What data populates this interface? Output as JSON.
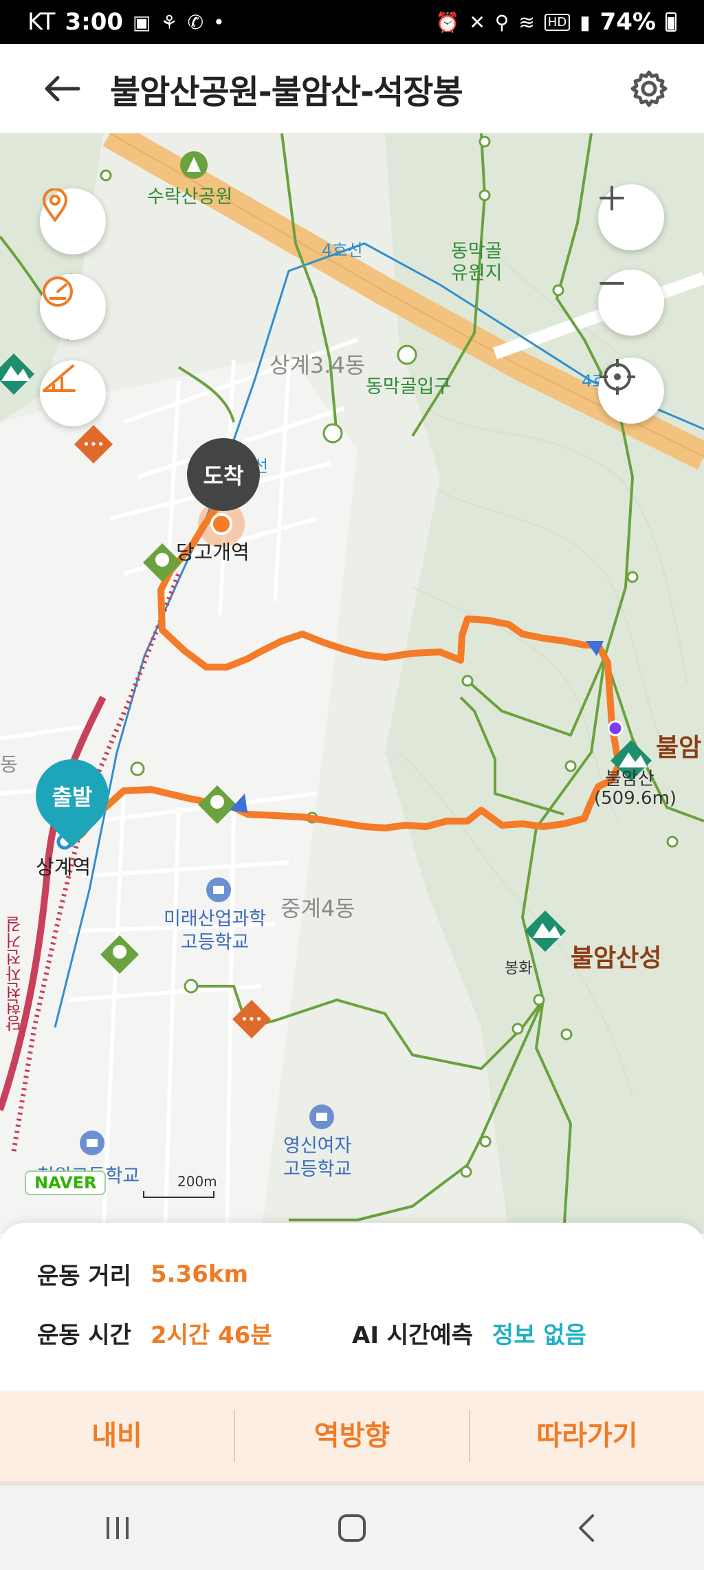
{
  "status_bar": {
    "carrier": "KT",
    "time": "3:00",
    "battery": "74%",
    "left_icons": [
      "gallery-icon",
      "sports-icon",
      "call-icon",
      "dot-icon"
    ],
    "right_icons": [
      "alarm-icon",
      "mute-icon",
      "location-icon",
      "wifi-icon",
      "hd-icon",
      "signal-icon"
    ]
  },
  "header": {
    "title": "불암산공원-불암산-석장봉",
    "back_icon": "arrow-left-icon",
    "settings_icon": "gear-icon"
  },
  "map": {
    "labels": {
      "suraksan_park": "수락산공원",
      "line4_top": "4호선",
      "line4_right": "4호",
      "dongmakgol_resort": "동막골\n유원지",
      "dong_sanggye34": "상계3.4동",
      "dongmakgol_entrance": "동막골입구",
      "danggogae_station": "당고개역",
      "sanggye_station": "상계역",
      "dong_junggye4": "중계4동",
      "mirae_school": "미래산업과학\n고등학교",
      "yeongsin_school": "영신여자\n고등학교",
      "bottom_school": "청원고등학교",
      "buramsan": "불암",
      "buramsan_name": "불암산",
      "buramsan_height": "(509.6m)",
      "buramsanseong": "불암산성",
      "bonghwa": "봉화",
      "danghyeon_stream": "당현천자전거길",
      "left_edge_1": "동",
      "left_edge_2": "선"
    },
    "markers": {
      "end": "도착",
      "start": "출발"
    },
    "controls": [
      {
        "name": "location-pin-button",
        "icon": "location-pin-icon"
      },
      {
        "name": "speed-button",
        "icon": "speedometer-icon"
      },
      {
        "name": "slope-button",
        "icon": "slope-icon"
      },
      {
        "name": "zoom-in-button",
        "icon": "plus-icon"
      },
      {
        "name": "zoom-out-button",
        "icon": "minus-icon"
      },
      {
        "name": "my-location-button",
        "icon": "crosshair-icon"
      }
    ],
    "logo": "NAVER",
    "scale": "200m",
    "colors": {
      "route": "#f47b28",
      "trail": "#6aa23e",
      "road_major": "#f2c27e",
      "rail": "#2f8ed1"
    }
  },
  "info": {
    "distance_label": "운동 거리",
    "distance_value": "5.36km",
    "time_label": "운동 시간",
    "time_value": "2시간 46분",
    "ai_label": "AI 시간예측",
    "ai_value": "정보 없음"
  },
  "actions": {
    "navigate": "내비",
    "reverse": "역방향",
    "follow": "따라가기"
  },
  "nav_bar": {
    "recents_icon": "recents-icon",
    "home_icon": "home-icon",
    "back_icon": "back-chevron-icon"
  }
}
